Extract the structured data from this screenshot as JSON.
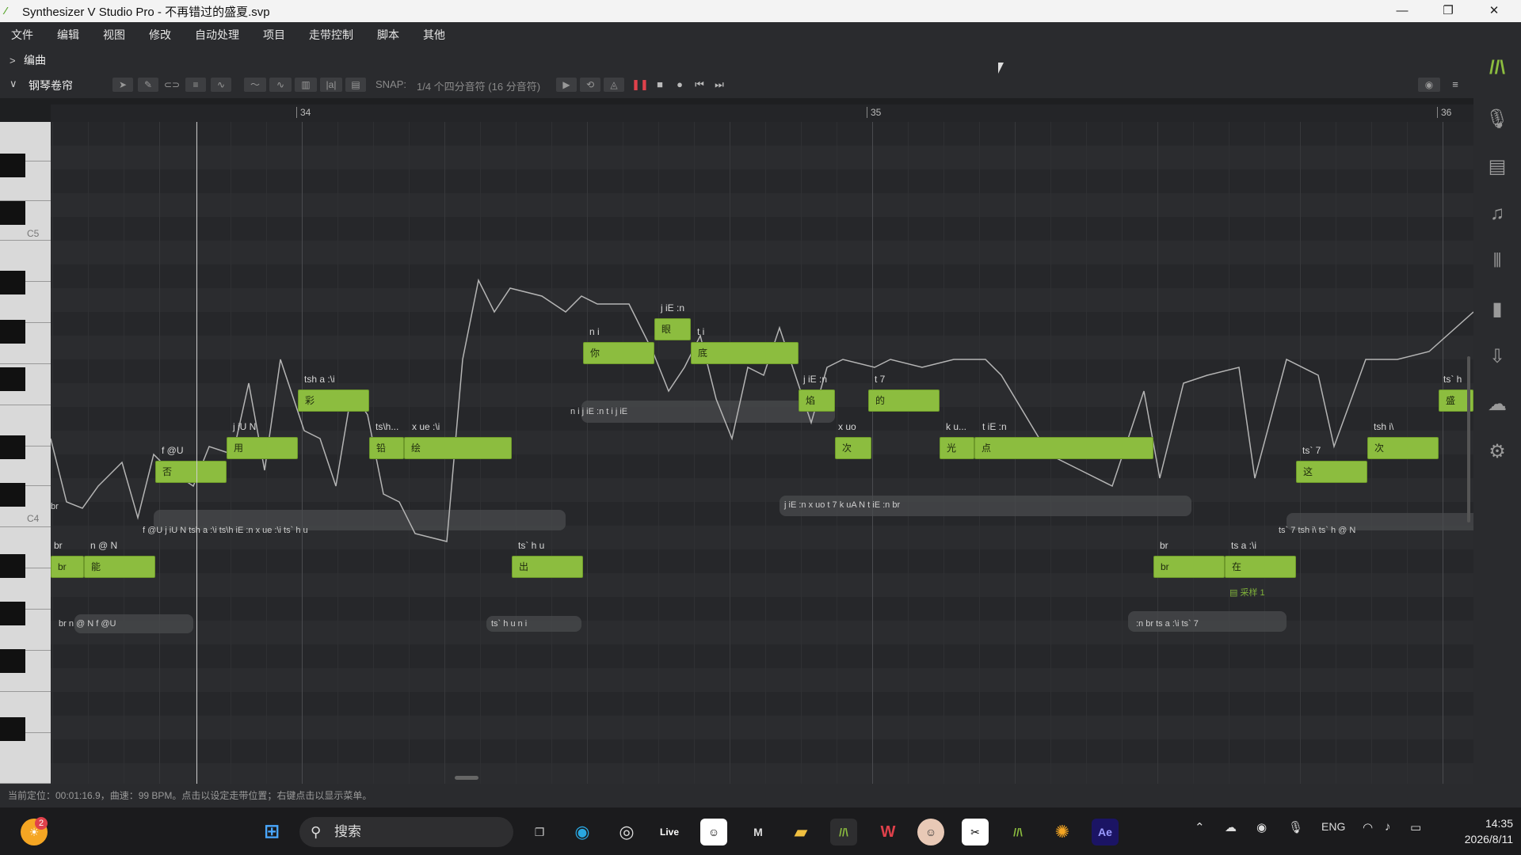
{
  "window": {
    "title": "Synthesizer V Studio Pro - 不再错过的盛夏.svp",
    "minimize": "—",
    "maximize": "❐",
    "close": "✕"
  },
  "menu": [
    "文件",
    "编辑",
    "视图",
    "修改",
    "自动处理",
    "项目",
    "走带控制",
    "脚本",
    "其他"
  ],
  "sections": {
    "arrange": "编曲",
    "piano_roll": "钢琴卷帘"
  },
  "snap": {
    "label": "SNAP:",
    "value": "1/4 个四分音符 (16 分音符)"
  },
  "ruler": [
    "34",
    "35",
    "36"
  ],
  "key_labels": [
    "C5",
    "C4"
  ],
  "notes": [
    {
      "lyric": "br",
      "phonemes": "br"
    },
    {
      "lyric": "能",
      "phonemes": "n @ N"
    },
    {
      "lyric": "否",
      "phonemes": "f @U"
    },
    {
      "lyric": "用",
      "phonemes": "j iU N"
    },
    {
      "lyric": "彩",
      "phonemes": "tsh a :\\i"
    },
    {
      "lyric": "铅",
      "phonemes": "ts\\h..."
    },
    {
      "lyric": "绘",
      "phonemes": "x ue :\\i"
    },
    {
      "lyric": "出",
      "phonemes": "ts` h u"
    },
    {
      "lyric": "你",
      "phonemes": "n i"
    },
    {
      "lyric": "眼",
      "phonemes": "j iE :n"
    },
    {
      "lyric": "底",
      "phonemes": "t i"
    },
    {
      "lyric": "焰",
      "phonemes": "j iE :n"
    },
    {
      "lyric": "次",
      "phonemes": "x uo"
    },
    {
      "lyric": "的",
      "phonemes": "t 7"
    },
    {
      "lyric": "光",
      "phonemes": "k u..."
    },
    {
      "lyric": "点",
      "phonemes": "t iE :n"
    },
    {
      "lyric": "br",
      "phonemes": "br"
    },
    {
      "lyric": "在",
      "phonemes": "ts a :\\i"
    },
    {
      "lyric": "这",
      "phonemes": "ts` 7"
    },
    {
      "lyric": "次",
      "phonemes": "tsh i\\"
    },
    {
      "lyric": "盛",
      "phonemes": "ts` h"
    }
  ],
  "phoneme_rows": [
    "br",
    "f    @U    j    iU    N    tsh    a    :\\i  ts\\h  iE  :n  x    ue    :\\i    ts`  h    u",
    "n    i    j  iE  :n  t    i    j    iE",
    "j   iE  :n  x   uo  t    7    k   uA  N   t       iE       :n   br",
    "ts`   7   tsh   i\\   ts` h   @   N",
    "br   n   @   N   f   @U",
    "ts` h   u   n   i",
    ":n   br   ts   a   :\\i   ts`   7"
  ],
  "take_label": "采样 1",
  "status": "当前定位：00:01:16.9，曲速：99 BPM。点击以设定走带位置；右键点击以显示菜单。",
  "taskbar": {
    "search_placeholder": "搜索",
    "badge": "2",
    "apps": [
      "Live",
      "Ae"
    ],
    "tray_lang": "ENG",
    "time": "14:35",
    "date": "2026/8/11"
  }
}
